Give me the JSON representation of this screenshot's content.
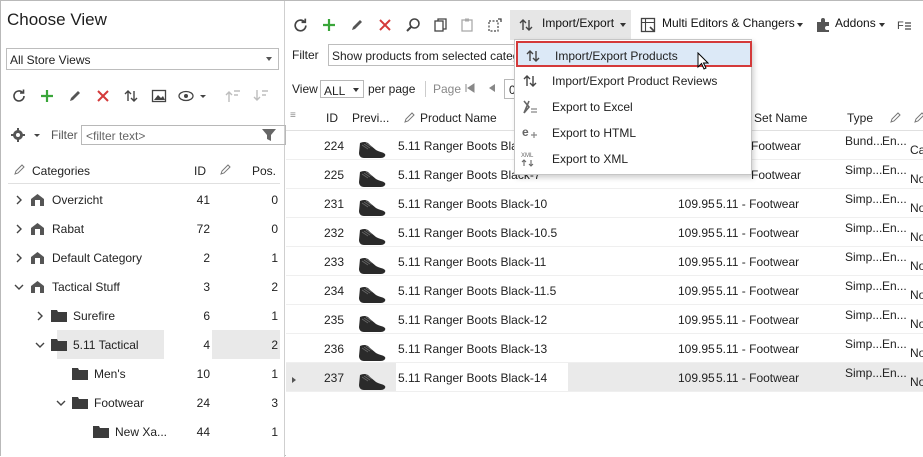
{
  "left": {
    "title": "Choose View",
    "store_select": "All Store Views",
    "filter_label": "Filter",
    "filter_placeholder": "<filter text>",
    "tree_headers": {
      "categories": "Categories",
      "id": "ID",
      "pos": "Pos."
    },
    "tree": [
      {
        "label": "Overzicht",
        "id": "41",
        "pos": "0",
        "level": 0,
        "kind": "store",
        "expander": "collapsed"
      },
      {
        "label": "Rabat",
        "id": "72",
        "pos": "0",
        "level": 0,
        "kind": "store",
        "expander": "collapsed"
      },
      {
        "label": "Default Category",
        "id": "2",
        "pos": "1",
        "level": 0,
        "kind": "store",
        "expander": "collapsed"
      },
      {
        "label": "Tactical Stuff",
        "id": "3",
        "pos": "2",
        "level": 0,
        "kind": "store",
        "expander": "expanded"
      },
      {
        "label": "Surefire",
        "id": "6",
        "pos": "1",
        "level": 1,
        "kind": "folder",
        "expander": "collapsed"
      },
      {
        "label": "5.11 Tactical",
        "id": "4",
        "pos": "2",
        "level": 1,
        "kind": "folder",
        "expander": "expanded",
        "selected": true
      },
      {
        "label": "Men's",
        "id": "10",
        "pos": "1",
        "level": 2,
        "kind": "folder",
        "expander": "none"
      },
      {
        "label": "Footwear",
        "id": "24",
        "pos": "3",
        "level": 2,
        "kind": "folder",
        "expander": "expanded"
      },
      {
        "label": "New Xa...",
        "id": "44",
        "pos": "1",
        "level": 3,
        "kind": "folder",
        "expander": "none"
      }
    ]
  },
  "toolbar": {
    "import_export": "Import/Export",
    "multi_editors": "Multi Editors & Changers",
    "addons": "Addons"
  },
  "filter_bar": {
    "label": "Filter",
    "value": "Show products from selected catego"
  },
  "pager": {
    "view_label": "View",
    "view_value": "ALL",
    "per_page": "per page",
    "page_label": "Page",
    "page_value": "0"
  },
  "grid": {
    "headers": {
      "id": "ID",
      "preview": "Previ...",
      "name": "Product Name",
      "attr_set": "ute Set Name",
      "type": "Type"
    },
    "rows": [
      {
        "id": "224",
        "name": "5.11 Ranger Boots Black",
        "price": "",
        "attr": "Footwear",
        "type": "Bund...",
        "en": "En...",
        "extra": "Ca"
      },
      {
        "id": "225",
        "name": "5.11 Ranger Boots Black-7",
        "price": "",
        "attr": "Footwear",
        "type": "Simp...",
        "en": "En...",
        "extra": "No"
      },
      {
        "id": "231",
        "name": "5.11 Ranger Boots Black-10",
        "price": "109.95",
        "attr": "5.11 - Footwear",
        "type": "Simp...",
        "en": "En...",
        "extra": "No"
      },
      {
        "id": "232",
        "name": "5.11 Ranger Boots Black-10.5",
        "price": "109.95",
        "attr": "5.11 - Footwear",
        "type": "Simp...",
        "en": "En...",
        "extra": "No"
      },
      {
        "id": "233",
        "name": "5.11 Ranger Boots Black-11",
        "price": "109.95",
        "attr": "5.11 - Footwear",
        "type": "Simp...",
        "en": "En...",
        "extra": "No"
      },
      {
        "id": "234",
        "name": "5.11 Ranger Boots Black-11.5",
        "price": "109.95",
        "attr": "5.11 - Footwear",
        "type": "Simp...",
        "en": "En...",
        "extra": "No"
      },
      {
        "id": "235",
        "name": "5.11 Ranger Boots Black-12",
        "price": "109.95",
        "attr": "5.11 - Footwear",
        "type": "Simp...",
        "en": "En...",
        "extra": "No"
      },
      {
        "id": "236",
        "name": "5.11 Ranger Boots Black-13",
        "price": "109.95",
        "attr": "5.11 - Footwear",
        "type": "Simp...",
        "en": "En...",
        "extra": "No"
      },
      {
        "id": "237",
        "name": "5.11 Ranger Boots Black-14",
        "price": "109.95",
        "attr": "5.11 - Footwear",
        "type": "Simp...",
        "en": "En...",
        "extra": "No",
        "selected": true
      }
    ]
  },
  "menu": {
    "items": [
      {
        "label": "Import/Export Products",
        "icon": "import-export-icon",
        "highlighted": true
      },
      {
        "label": "Import/Export Product Reviews",
        "icon": "import-export-icon"
      },
      {
        "label": "Export to Excel",
        "icon": "excel-icon"
      },
      {
        "label": "Export  to HTML",
        "icon": "html-icon"
      },
      {
        "label": "Export to XML",
        "icon": "xml-icon"
      }
    ]
  },
  "colors": {
    "add_green": "#3aa63a",
    "delete_red": "#d43a3a",
    "highlight_border": "#d43a3a",
    "highlight_bg": "#dce9f7"
  }
}
